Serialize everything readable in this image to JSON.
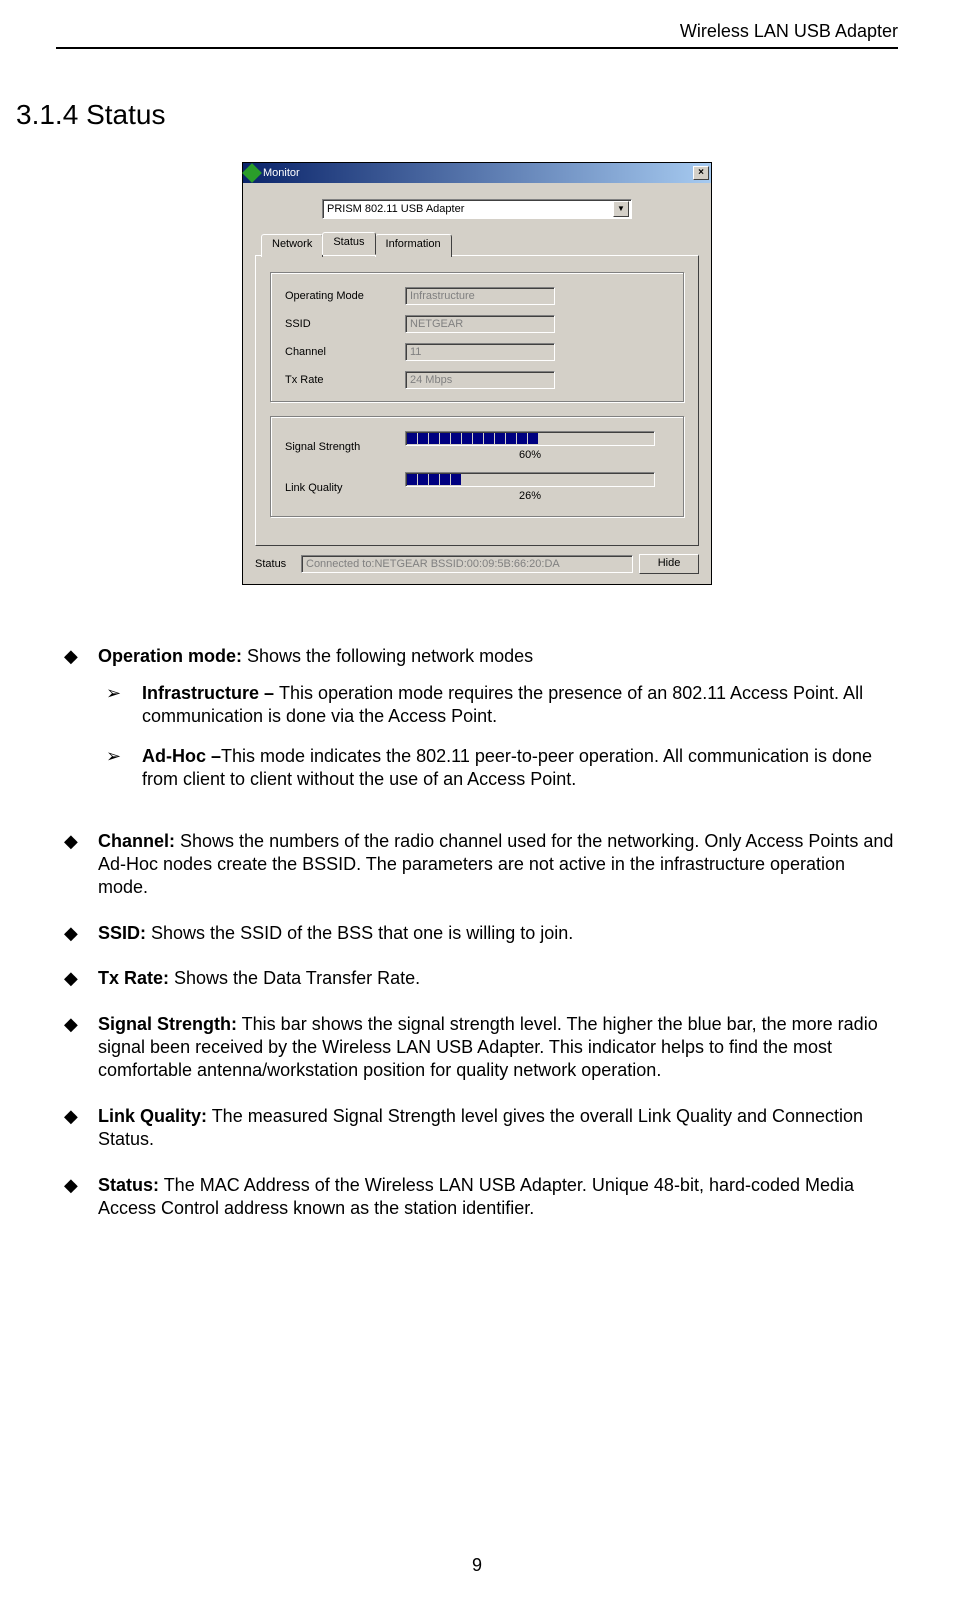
{
  "header": {
    "title": "Wireless LAN USB Adapter"
  },
  "section": {
    "number": "3.1.4",
    "title": "Status"
  },
  "monitor": {
    "title": "Monitor",
    "close": "×",
    "adapter": {
      "selected": "PRISM 802.11 USB Adapter"
    },
    "tabs": {
      "network": "Network",
      "status": "Status",
      "information": "Information"
    },
    "fields": {
      "operating_mode_label": "Operating Mode",
      "operating_mode_value": "Infrastructure",
      "ssid_label": "SSID",
      "ssid_value": "NETGEAR",
      "channel_label": "Channel",
      "channel_value": "11",
      "tx_rate_label": "Tx Rate",
      "tx_rate_value": "24 Mbps"
    },
    "bars": {
      "signal_label": "Signal Strength",
      "signal_pct": "60%",
      "signal_segments": 20,
      "signal_filled": 12,
      "link_label": "Link Quality",
      "link_pct": "26%",
      "link_segments": 20,
      "link_filled": 5
    },
    "status": {
      "label": "Status",
      "value": "Connected to:NETGEAR   BSSID:00:09:5B:66:20:DA",
      "hide": "Hide"
    }
  },
  "desc": {
    "op_mode_label": "Operation mode:",
    "op_mode_text": " Shows the following network modes",
    "infra_label": "Infrastructure – ",
    "infra_text": "This operation mode requires the presence of an 802.11 Access Point. All communication is done via the Access Point.",
    "adhoc_label": "Ad-Hoc –",
    "adhoc_text": "This mode indicates the 802.11 peer-to-peer operation. All communication is done from client to client without the use of an Access Point.",
    "channel_label": "Channel:",
    "channel_text": " Shows the numbers of the radio channel used for the networking. Only Access Points and Ad-Hoc nodes create the BSSID. The parameters are not active in the infrastructure operation mode.",
    "ssid_label": "SSID:",
    "ssid_text": " Shows the SSID of the BSS that one is willing to join.",
    "tx_label": "Tx Rate:",
    "tx_text": " Shows the Data Transfer Rate.",
    "signal_label": "Signal Strength:",
    "signal_text": " This bar shows the signal strength level. The higher the blue bar, the more radio signal been received by the Wireless LAN USB Adapter. This indicator helps to find the most comfortable antenna/workstation position for quality network operation.",
    "link_label": "Link Quality:",
    "link_text": " The measured Signal Strength level gives the overall Link Quality and Connection Status.",
    "status_label": "Status:",
    "status_text": " The MAC Address of the Wireless LAN USB Adapter. Unique 48-bit, hard-coded Media Access Control address known as the station identifier."
  },
  "page_number": "9",
  "glyphs": {
    "diamond": "◆",
    "chevron": "➢",
    "down": "▼"
  }
}
